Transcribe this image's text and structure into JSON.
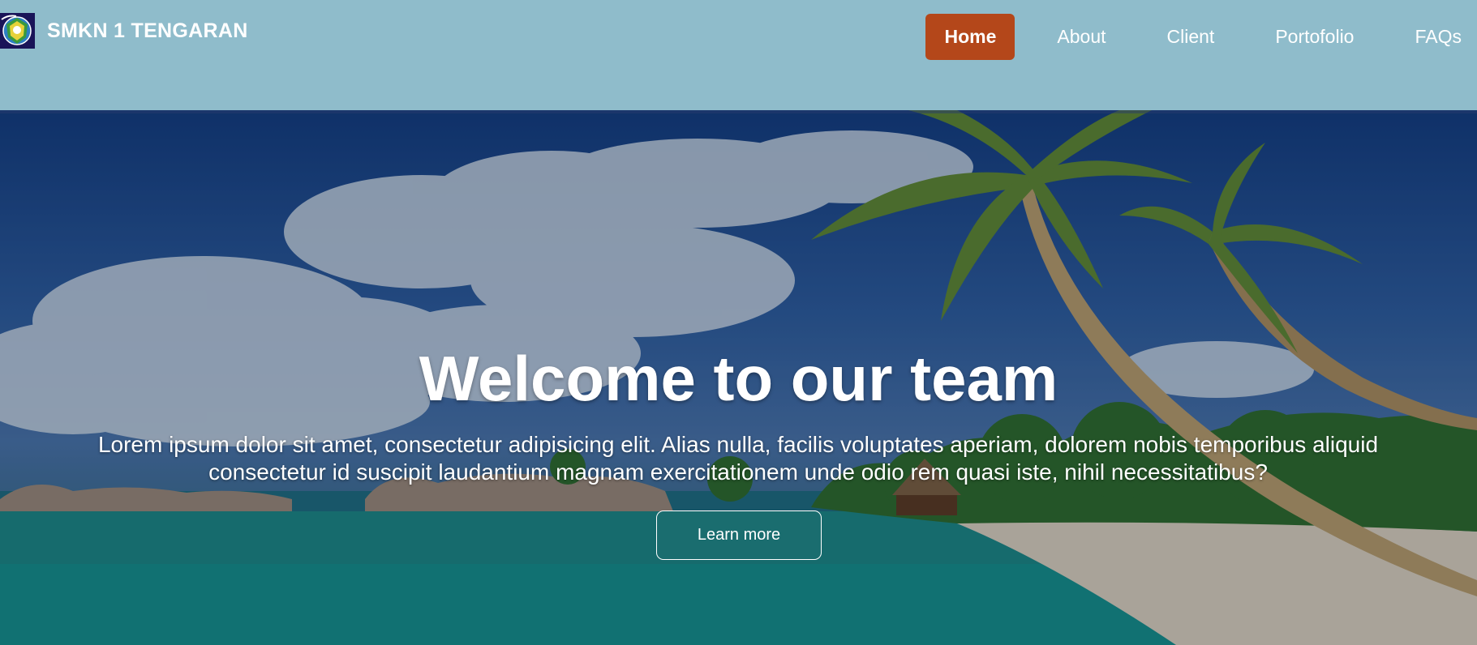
{
  "brand": {
    "name": "SMKN 1 TENGARAN",
    "logo_icon": "school-emblem-icon"
  },
  "nav": {
    "items": [
      {
        "label": "Home",
        "active": true
      },
      {
        "label": "About",
        "active": false
      },
      {
        "label": "Client",
        "active": false
      },
      {
        "label": "Portofolio",
        "active": false
      },
      {
        "label": "FAQs",
        "active": false
      }
    ]
  },
  "hero": {
    "title": "Welcome to our team",
    "text": "Lorem ipsum dolor sit amet, consectetur adipisicing elit. Alias nulla, facilis voluptates aperiam, dolorem nobis temporibus aliquid consectetur id suscipit laudantium magnam exercitationem unde odio rem quasi iste, nihil necessitatibus?",
    "button_label": "Learn more",
    "background": "tropical-beach-palm-trees-image"
  },
  "colors": {
    "navbar_bg": "#8fbccb",
    "active_nav_bg": "#b4471a",
    "text": "#ffffff"
  }
}
